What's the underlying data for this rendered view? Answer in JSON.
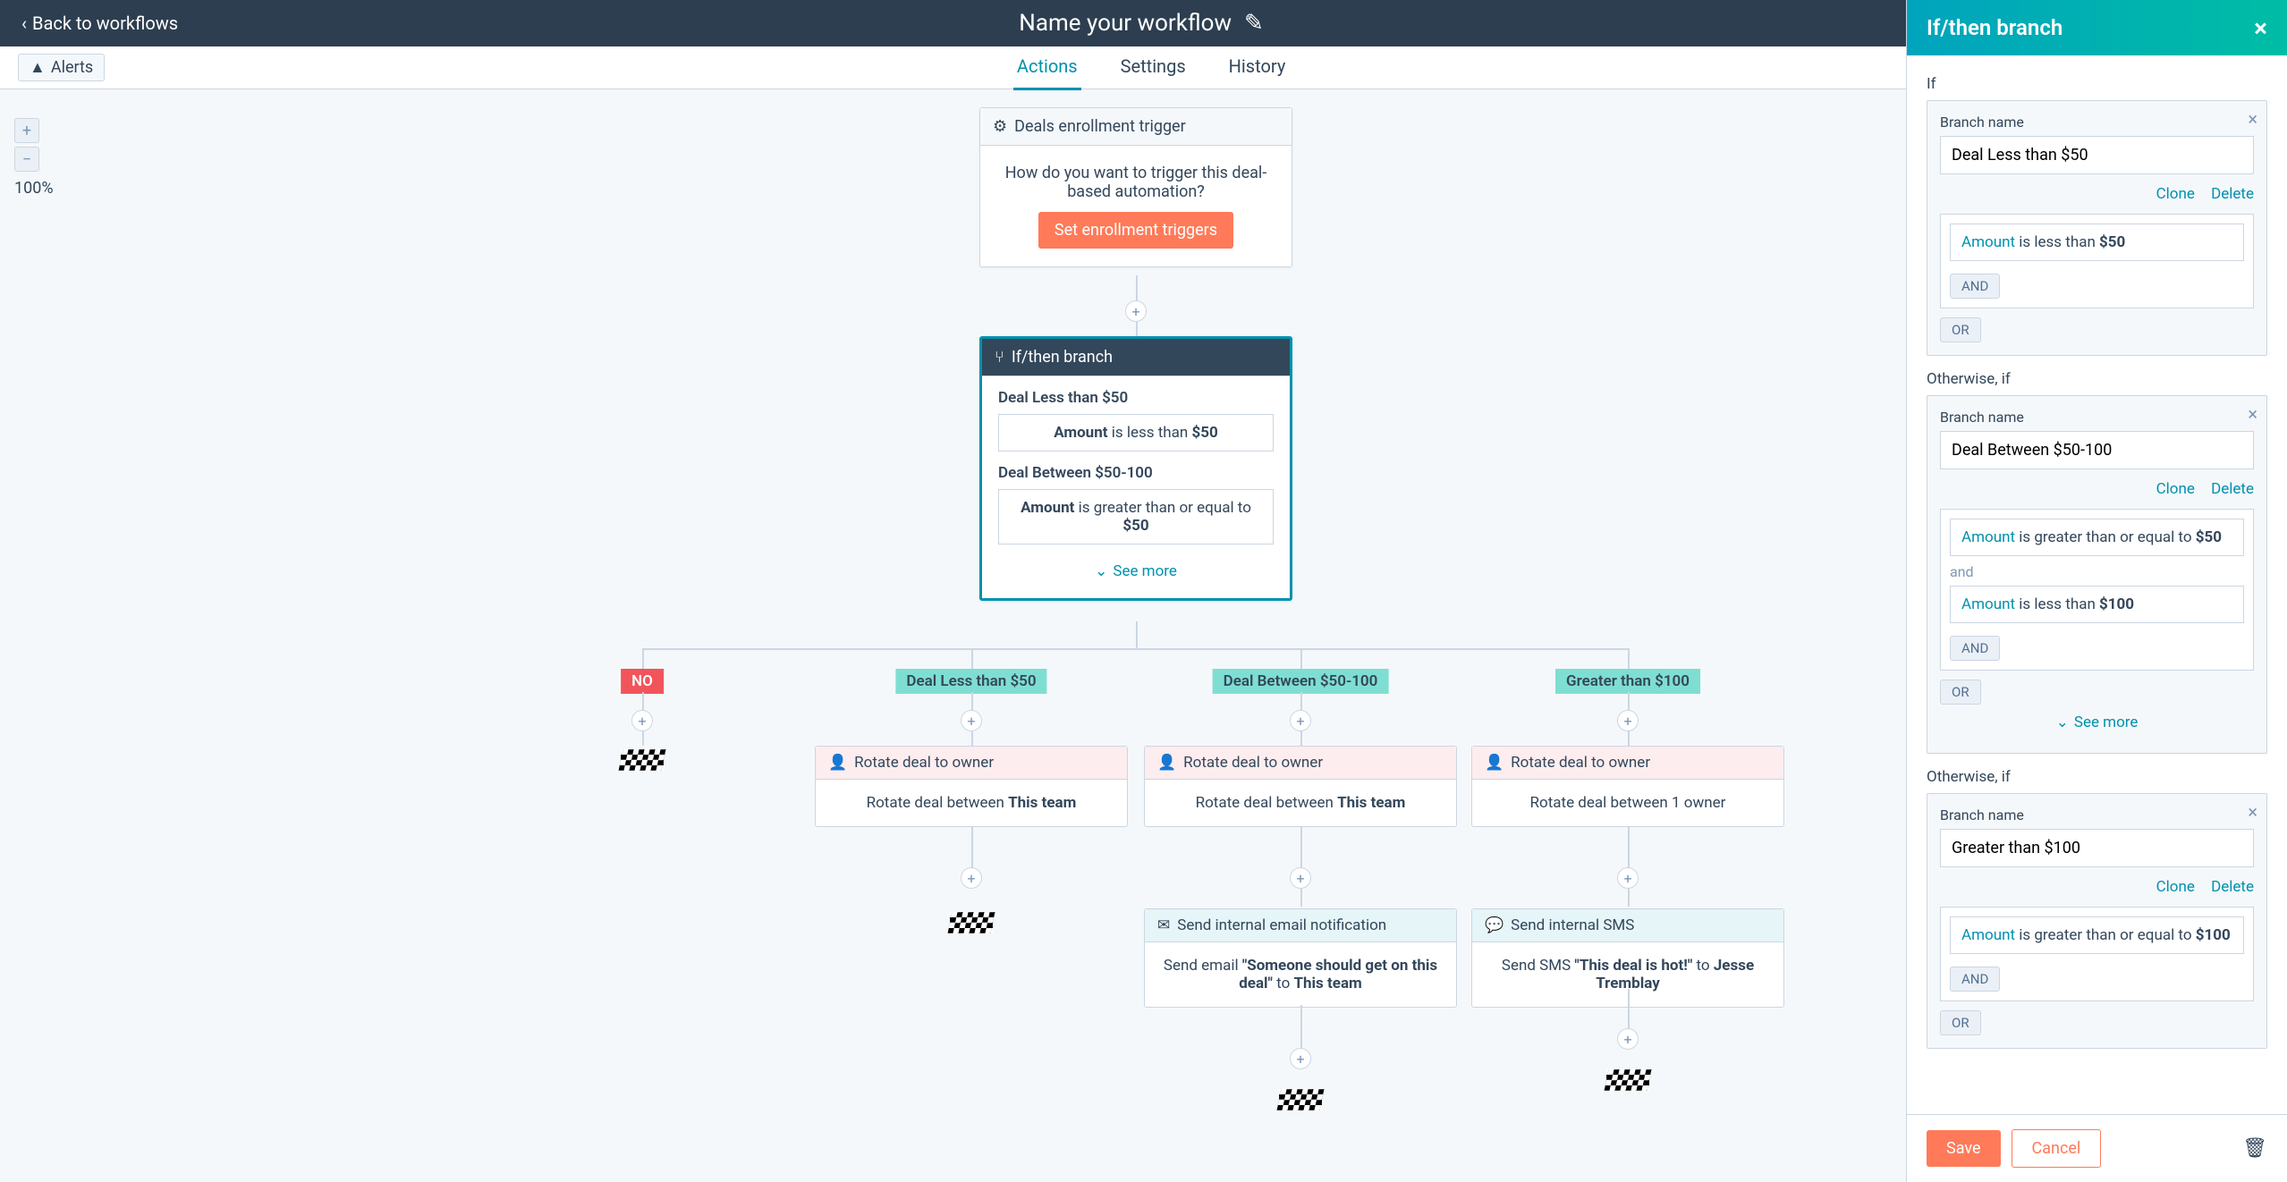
{
  "topbar": {
    "back": "Back to workflows",
    "title": "Name your workflow"
  },
  "subbar": {
    "alerts": "Alerts",
    "tabs": [
      "Actions",
      "Settings",
      "History"
    ],
    "active_tab": 0
  },
  "zoom": {
    "level": "100%"
  },
  "trigger": {
    "header": "Deals enrollment trigger",
    "body": "How do you want to trigger this deal-based automation?",
    "button": "Set enrollment triggers"
  },
  "branch_node": {
    "header": "If/then branch",
    "entries": [
      {
        "title": "Deal Less than $50",
        "prop": "Amount",
        "op": " is less than ",
        "val": "$50"
      },
      {
        "title": "Deal Between $50-100",
        "prop": "Amount",
        "op": " is greater than or equal to ",
        "val": "$50"
      }
    ],
    "see_more": "See more"
  },
  "branch_labels": {
    "no": "NO",
    "b1": "Deal Less than $50",
    "b2": "Deal Between $50-100",
    "b3": "Greater than $100"
  },
  "rotate_cards": {
    "header": "Rotate deal to owner",
    "c1": {
      "prefix": "Rotate deal between ",
      "bold": "This team"
    },
    "c2": {
      "prefix": "Rotate deal between ",
      "bold": "This team"
    },
    "c3": {
      "text": "Rotate deal between 1 owner"
    }
  },
  "email_card": {
    "header": "Send internal email notification",
    "p1": "Send email ",
    "q": "\"Someone should get on this deal\"",
    "p2": " to ",
    "bold": "This team"
  },
  "sms_card": {
    "header": "Send internal SMS",
    "p1": "Send SMS ",
    "q": "\"This deal is hot!\"",
    "p2": " to ",
    "bold": "Jesse Tremblay"
  },
  "panel": {
    "title": "If/then branch",
    "if": "If",
    "otherwise": "Otherwise, if",
    "branch_name_label": "Branch name",
    "clone": "Clone",
    "delete": "Delete",
    "and_btn": "AND",
    "or_btn": "OR",
    "see_more": "See more",
    "b1": {
      "name": "Deal Less than $50",
      "conds": [
        {
          "prop": "Amount",
          "op": " is less than ",
          "val": "$50"
        }
      ]
    },
    "b2": {
      "name": "Deal Between $50-100",
      "conds": [
        {
          "prop": "Amount",
          "op": " is greater than or equal to ",
          "val": "$50"
        },
        {
          "and": "and"
        },
        {
          "prop": "Amount",
          "op": " is less than ",
          "val": "$100"
        }
      ]
    },
    "b3": {
      "name": "Greater than $100",
      "conds": [
        {
          "prop": "Amount",
          "op": " is greater than or equal to ",
          "val": "$100"
        }
      ]
    },
    "save": "Save",
    "cancel": "Cancel"
  }
}
